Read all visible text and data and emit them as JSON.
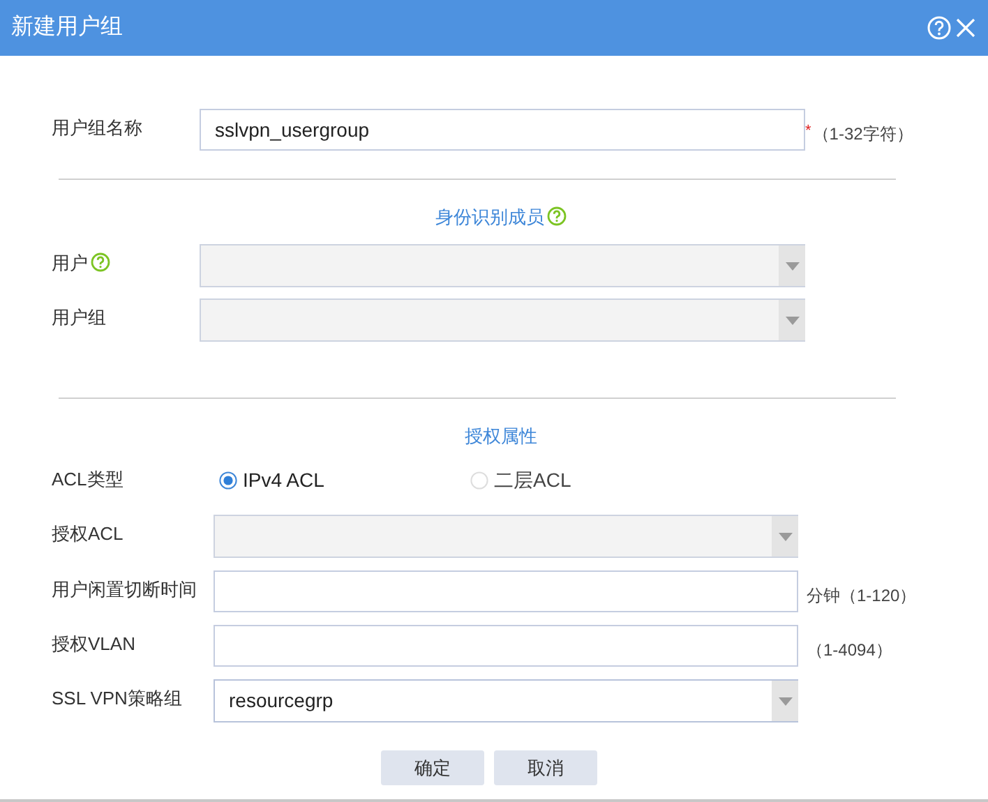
{
  "window": {
    "title": "新建用户组"
  },
  "sections": [
    {
      "rows": [
        {
          "kind": "text",
          "label": "用户组名称",
          "value": "sslvpn_usergroup",
          "required_mark": "*",
          "hint": "（1-32字符）"
        }
      ]
    },
    {
      "title": "身份识别成员",
      "help": true,
      "rows": [
        {
          "kind": "select",
          "label": "用户",
          "help": true,
          "disabled": true
        },
        {
          "kind": "select",
          "label": "用户组",
          "disabled": true
        }
      ]
    },
    {
      "title": "授权属性",
      "rows": [
        {
          "kind": "radio",
          "label": "ACL类型",
          "options": [
            {
              "label": "IPv4 ACL",
              "selected": true
            },
            {
              "label": "二层ACL",
              "selected": false
            }
          ]
        },
        {
          "kind": "select",
          "label": "授权ACL",
          "disabled": true
        },
        {
          "kind": "text",
          "label": "用户闲置切断时间",
          "hint": "分钟（1-120）"
        },
        {
          "kind": "text",
          "label": "授权VLAN",
          "hint": "（1-4094）"
        },
        {
          "kind": "select",
          "label": "SSL VPN策略组",
          "disabled": false,
          "value": "resourcegrp"
        }
      ]
    }
  ],
  "buttons": [
    "确定",
    "取消"
  ]
}
